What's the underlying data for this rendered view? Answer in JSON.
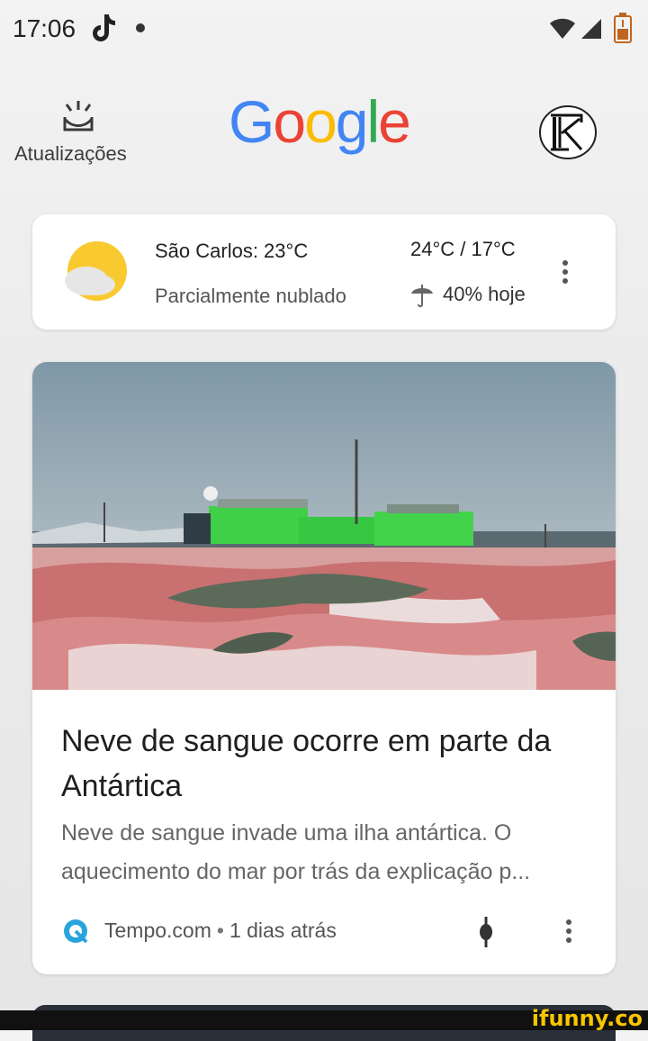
{
  "status_bar": {
    "time": "17:06",
    "icons": [
      "tiktok-icon",
      "notification-dot",
      "wifi-icon",
      "signal-icon",
      "battery-icon"
    ]
  },
  "header": {
    "updates_label": "Atualizações",
    "logo_letters": [
      {
        "char": "G",
        "color": "#4285F4"
      },
      {
        "char": "o",
        "color": "#EA4335"
      },
      {
        "char": "o",
        "color": "#FBBC05"
      },
      {
        "char": "g",
        "color": "#4285F4"
      },
      {
        "char": "l",
        "color": "#34A853"
      },
      {
        "char": "e",
        "color": "#EA4335"
      }
    ],
    "avatar_icon": "profile-avatar"
  },
  "weather": {
    "city_temp": "São Carlos: 23°C",
    "condition": "Parcialmente nublado",
    "high_low": "24°C / 17°C",
    "rain_chance": "40% hoje",
    "icon": "partly-cloudy-icon"
  },
  "news": {
    "headline": "Neve de sangue ocorre em parte da Antártica",
    "snippet": "Neve de sangue invade uma ilha antártica. O aquecimento do mar por trás da explicação p...",
    "source": "Tempo.com",
    "separator": "•",
    "time": "1 dias atrás"
  },
  "watermark": "ifunny.co"
}
